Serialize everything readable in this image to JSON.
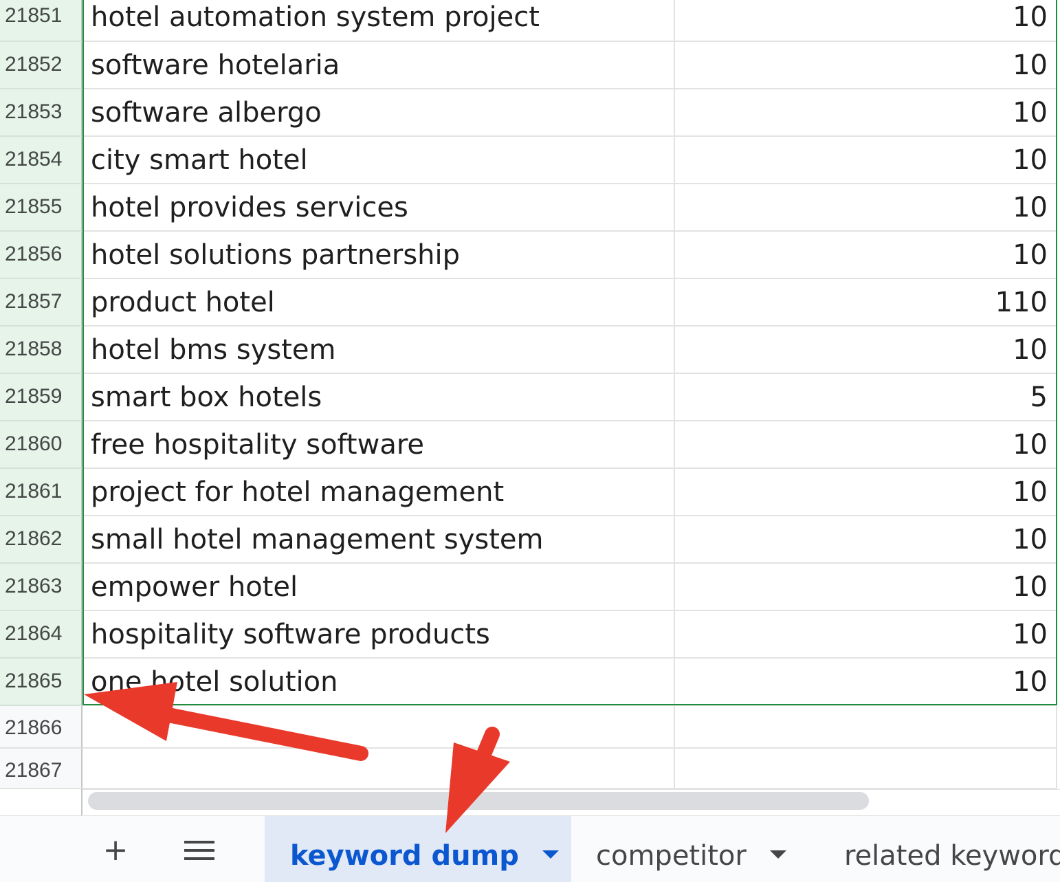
{
  "rows": [
    {
      "num": "21851",
      "keyword": "hotel automation system project",
      "volume": "10"
    },
    {
      "num": "21852",
      "keyword": "software hotelaria",
      "volume": "10"
    },
    {
      "num": "21853",
      "keyword": "software albergo",
      "volume": "10"
    },
    {
      "num": "21854",
      "keyword": "city smart hotel",
      "volume": "10"
    },
    {
      "num": "21855",
      "keyword": "hotel provides services",
      "volume": "10"
    },
    {
      "num": "21856",
      "keyword": "hotel solutions partnership",
      "volume": "10"
    },
    {
      "num": "21857",
      "keyword": "product hotel",
      "volume": "110"
    },
    {
      "num": "21858",
      "keyword": "hotel bms system",
      "volume": "10"
    },
    {
      "num": "21859",
      "keyword": "smart box hotels",
      "volume": "5"
    },
    {
      "num": "21860",
      "keyword": "free hospitality software",
      "volume": "10"
    },
    {
      "num": "21861",
      "keyword": "project for hotel management",
      "volume": "10"
    },
    {
      "num": "21862",
      "keyword": "small hotel management system",
      "volume": "10"
    },
    {
      "num": "21863",
      "keyword": "empower hotel",
      "volume": "10"
    },
    {
      "num": "21864",
      "keyword": "hospitality software products",
      "volume": "10"
    },
    {
      "num": "21865",
      "keyword": "one hotel solution",
      "volume": "10"
    }
  ],
  "empty_rows": [
    {
      "num": "21866"
    },
    {
      "num": "21867"
    }
  ],
  "tabbar": {
    "add_icon": "+",
    "menu_icon": "≡",
    "tabs": [
      {
        "label": "keyword dump",
        "active": true
      },
      {
        "label": "competitor",
        "active": false
      },
      {
        "label": "related keywords",
        "active": false
      }
    ]
  },
  "colors": {
    "selection_border": "#1e8e3e",
    "active_tab_bg": "#e1e9f7",
    "active_tab_text": "#0b57d0",
    "annotation_arrow": "#e8392b"
  }
}
